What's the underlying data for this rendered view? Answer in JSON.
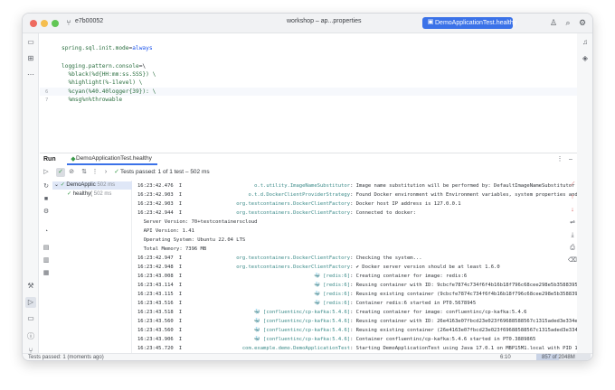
{
  "titlebar": {
    "project": "e7b00052",
    "file_title": "workshop – ap...properties",
    "run_config": "DemoApplicationTest.healthy"
  },
  "editor": {
    "lines": [
      {
        "num": "",
        "key": "spring.sql.init.mode",
        "eq": "=",
        "value": "always"
      },
      {
        "num": "",
        "key": "",
        "eq": "",
        "value": ""
      },
      {
        "num": "",
        "key": "logging.pattern.console",
        "eq": "=",
        "value": "\\"
      },
      {
        "num": "",
        "key": "",
        "eq": "",
        "value": "  %black(%d{HH:mm:ss.SSS}) \\"
      },
      {
        "num": "",
        "key": "",
        "eq": "",
        "value": "  %highlight(%-1level) \\"
      },
      {
        "num": "6",
        "key": "",
        "eq": "",
        "value": "  %cyan(%40.40logger{39}): \\"
      },
      {
        "num": "7",
        "key": "",
        "eq": "",
        "value": "  %msg%n%throwable"
      }
    ]
  },
  "run_panel": {
    "tab_label": "Run",
    "config_tab": "DemoApplicationTest.healthy",
    "tests_passed": "Tests passed: 1 of 1 test – 502 ms",
    "tree": [
      {
        "label": "DemoApplic",
        "duration": "502 ms"
      },
      {
        "label": "healthy(",
        "duration": "502 ms"
      }
    ],
    "console": [
      {
        "ts": "16:23:42.476",
        "lvl": "I",
        "src": "o.t.utility.ImageNameSubstitutor",
        "msg": ": Image name substitution will be performed by: DefaultImageNameSubstitutor (composit"
      },
      {
        "ts": "16:23:42.903",
        "lvl": "I",
        "src": "o.t.d.DockerClientProviderStrategy",
        "msg": ": Found Docker environment with Environment variables, system properties and defaults"
      },
      {
        "ts": "16:23:42.903",
        "lvl": "I",
        "src": "org.testcontainers.DockerClientFactory",
        "msg": ": Docker host IP address is 127.0.0.1"
      },
      {
        "ts": "16:23:42.944",
        "lvl": "I",
        "src": "org.testcontainers.DockerClientFactory",
        "msg": ": Connected to docker:"
      },
      {
        "ts": "",
        "lvl": "",
        "src": "",
        "msg": "  Server Version: 70+testcontainerscloud"
      },
      {
        "ts": "",
        "lvl": "",
        "src": "",
        "msg": "  API Version: 1.41"
      },
      {
        "ts": "",
        "lvl": "",
        "src": "",
        "msg": "  Operating System: Ubuntu 22.04 LTS"
      },
      {
        "ts": "",
        "lvl": "",
        "src": "",
        "msg": "  Total Memory: 7396 MB"
      },
      {
        "ts": "16:23:42.947",
        "lvl": "I",
        "src": "org.testcontainers.DockerClientFactory",
        "msg": ": Checking the system..."
      },
      {
        "ts": "16:23:42.948",
        "lvl": "I",
        "src": "org.testcontainers.DockerClientFactory",
        "msg": ": ✔ Docker server version should be at least 1.6.0"
      },
      {
        "ts": "16:23:43.008",
        "lvl": "I",
        "src": "🐳 [redis:6]",
        "msg": ": Creating container for image: redis:6"
      },
      {
        "ts": "16:23:43.114",
        "lvl": "I",
        "src": "🐳 [redis:6]",
        "msg": ": Reusing container with ID: 9cbcfe7874c734f6f4b16b18f796c68cee298e5b35883951f2aeef2"
      },
      {
        "ts": "16:23:43.115",
        "lvl": "I",
        "src": "🐳 [redis:6]",
        "msg": ": Reusing existing container (9cbcfe7874c734f6f4b16b18f796c68cee298e5b35883951f2aeef"
      },
      {
        "ts": "16:23:43.516",
        "lvl": "I",
        "src": "🐳 [redis:6]",
        "msg": ": Container redis:6 started in PT0.5678945"
      },
      {
        "ts": "16:23:43.518",
        "lvl": "I",
        "src": "🐳 [confluentinc/cp-kafka:5.4.6]",
        "msg": ": Creating container for image: confluentinc/cp-kafka:5.4.6"
      },
      {
        "ts": "16:23:43.560",
        "lvl": "I",
        "src": "🐳 [confluentinc/cp-kafka:5.4.6]",
        "msg": ": Reusing container with ID: 26e4163e07fbcd23e023f69688588567c1315aded3e334ec475e982"
      },
      {
        "ts": "16:23:43.560",
        "lvl": "I",
        "src": "🐳 [confluentinc/cp-kafka:5.4.6]",
        "msg": ": Reusing existing container (26e4163e07fbcd23e023f69688588567c1315aded3e334ec475e98"
      },
      {
        "ts": "16:23:43.906",
        "lvl": "I",
        "src": "🐳 [confluentinc/cp-kafka:5.4.6]",
        "msg": ": Container confluentinc/cp-kafka:5.4.6 started in PT0.3889865"
      },
      {
        "ts": "16:23:45.720",
        "lvl": "I",
        "src": "com.example.demo.DemoApplicationTest",
        "msg": ": Starting DemoApplicationTest using Java 17.0.1 on MBP15M1.local with PID 11022 (sta"
      }
    ]
  },
  "statusbar": {
    "left": "Tests passed: 1 (moments ago)",
    "position": "6:10",
    "memory": "857 of 2048M",
    "memory_fraction": 0.42
  },
  "colors": {
    "accent": "#3b72e8",
    "pass_green": "#3a9a4a",
    "logger_teal": "#3a8a88"
  }
}
